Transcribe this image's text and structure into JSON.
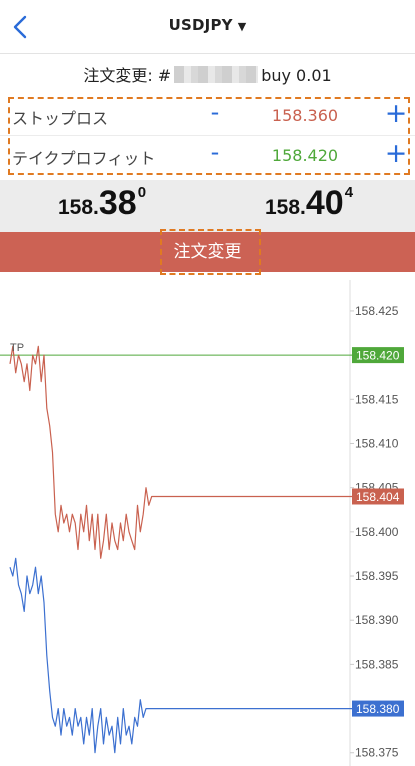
{
  "nav": {
    "title": "USDJPY",
    "caret": "▼",
    "back_icon": "chevron-left-icon"
  },
  "order": {
    "prefix": "注文変更: #",
    "suffix": "buy 0.01"
  },
  "stop_loss": {
    "label": "ストップロス",
    "minus": "-",
    "value": "158.360",
    "plus": "+",
    "color": "#c9614f"
  },
  "take_profit": {
    "label": "テイクプロフィット",
    "minus": "-",
    "value": "158.420",
    "plus": "+",
    "color": "#4fa83a"
  },
  "prices": {
    "bid": {
      "small": "158.",
      "big": "38",
      "sup": "0"
    },
    "ask": {
      "small": "158.",
      "big": "40",
      "sup": "4"
    }
  },
  "action_button": {
    "label": "注文変更"
  },
  "chart_data": {
    "type": "line",
    "ylim": [
      158.3735,
      158.4285
    ],
    "yticks": [
      "158.425",
      "158.420",
      "158.415",
      "158.410",
      "158.405",
      "158.400",
      "158.395",
      "158.390",
      "158.385",
      "158.380",
      "158.375"
    ],
    "tp_label": "TP",
    "tp_level": 158.42,
    "tp_tag": "158.420",
    "ask_level": 158.404,
    "ask_tag": "158.404",
    "bid_level": 158.38,
    "bid_tag": "158.380",
    "series": [
      {
        "color": "#c9614f",
        "values": [
          158.419,
          158.421,
          158.418,
          158.42,
          158.419,
          158.417,
          158.419,
          158.416,
          158.42,
          158.419,
          158.421,
          158.417,
          158.42,
          158.414,
          158.412,
          158.409,
          158.402,
          158.4,
          158.403,
          158.401,
          158.402,
          158.4,
          158.402,
          158.401,
          158.398,
          158.402,
          158.4,
          158.403,
          158.399,
          158.402,
          158.398,
          158.402,
          158.397,
          158.399,
          158.402,
          158.398,
          158.401,
          158.399,
          158.398,
          158.401,
          158.399,
          158.402,
          158.4,
          158.399,
          158.398,
          158.403,
          158.4,
          158.402,
          158.405,
          158.403,
          158.404,
          158.404,
          158.404,
          158.404
        ]
      },
      {
        "color": "#3c70d0",
        "values": [
          158.396,
          158.395,
          158.397,
          158.394,
          158.393,
          158.391,
          158.395,
          158.393,
          158.394,
          158.396,
          158.393,
          158.395,
          158.392,
          158.386,
          158.382,
          158.379,
          158.378,
          158.38,
          158.377,
          158.38,
          158.378,
          158.379,
          158.377,
          158.38,
          158.378,
          158.379,
          158.376,
          158.379,
          158.377,
          158.38,
          158.375,
          158.378,
          158.38,
          158.376,
          158.379,
          158.377,
          158.378,
          158.375,
          158.379,
          158.376,
          158.38,
          158.377,
          158.378,
          158.376,
          158.379,
          158.378,
          158.381,
          158.379,
          158.38,
          158.38,
          158.38,
          158.38,
          158.38,
          158.38
        ]
      }
    ]
  }
}
